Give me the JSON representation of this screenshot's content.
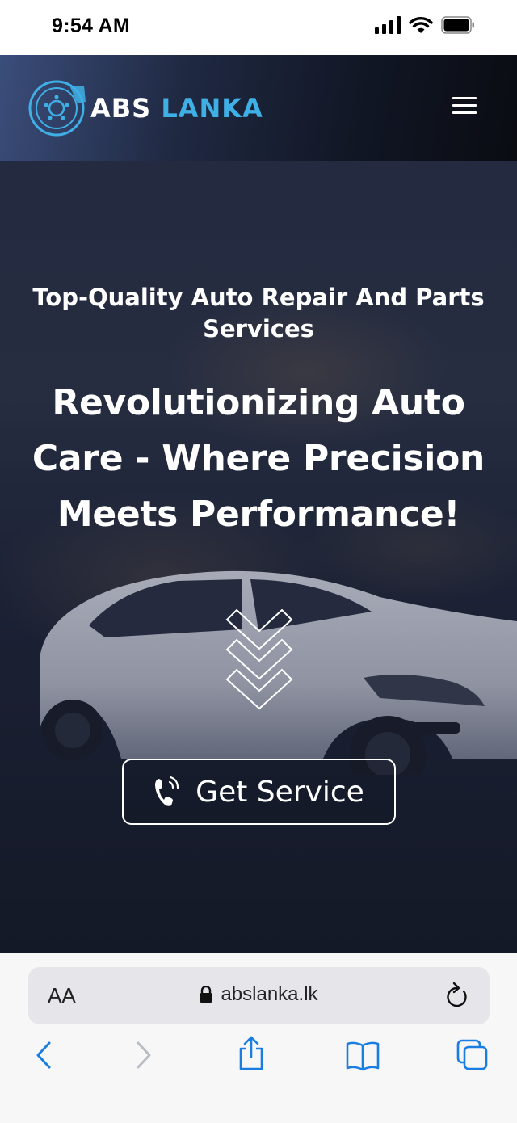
{
  "status_bar": {
    "time": "9:54 AM"
  },
  "header": {
    "logo_text_white": "ABS",
    "logo_text_blue": "LANKA"
  },
  "hero": {
    "subtitle": "Top-Quality Auto Repair And Parts Services",
    "title": "Revolutionizing Auto Care - Where Precision Meets Performance!",
    "cta_label": "Get Service"
  },
  "browser": {
    "aa_label": "AA",
    "url": "abslanka.lk"
  },
  "colors": {
    "brand_blue": "#3fb0e6",
    "ios_blue": "#1a7ee0"
  }
}
